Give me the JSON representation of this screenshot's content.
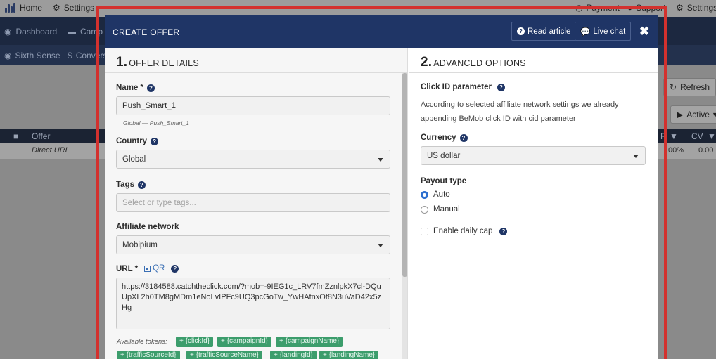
{
  "topbar": {
    "home": "Home",
    "settings_left": "Settings",
    "payment": "Payment",
    "support": "Support",
    "settings_right": "Settings"
  },
  "navbar": {
    "dashboard": "Dashboard",
    "campaigns": "Camp"
  },
  "subnav": {
    "sixth_sense": "Sixth Sense",
    "conversions": "Convers"
  },
  "toolbar": {
    "refresh": "Refresh",
    "active": "Active"
  },
  "table": {
    "col_offer": "Offer",
    "col_r": "R",
    "col_cv": "CV",
    "row_name": "Direct URL",
    "row_pct1": "00%",
    "row_pct2": "0.00"
  },
  "modal": {
    "title": "CREATE OFFER",
    "read_article": "Read article",
    "live_chat": "Live chat",
    "close": "✖"
  },
  "offer_details": {
    "num": "1.",
    "title": "OFFER DETAILS",
    "name_label": "Name *",
    "name_value": "Push_Smart_1",
    "name_hint": "Global — Push_Smart_1",
    "country_label": "Country",
    "country_value": "Global",
    "tags_label": "Tags",
    "tags_placeholder": "Select or type tags...",
    "affiliate_label": "Affiliate network",
    "affiliate_value": "Mobipium",
    "url_label": "URL *",
    "qr_label": "QR",
    "url_value": "https://3184588.catchtheclick.com/?mob=-9IEG1c_LRV7fmZznlpkX7cl-DQuUpXL2h0TM8gMDm1eNoLvIPFc9UQ3pcGoTw_YwHAfnxOf8N3uVaD42x5zHg",
    "tokens_label": "Available tokens:",
    "tokens": [
      "+ {clickId}",
      "+ {campaignId}",
      "+ {campaignName}",
      "+ {trafficSourceId}",
      "+ {trafficSourceName}",
      "+ {landingId}",
      "+ {landingName}"
    ]
  },
  "advanced": {
    "num": "2.",
    "title": "ADVANCED OPTIONS",
    "clickid_label": "Click ID parameter",
    "clickid_desc": "According to selected affiliate network settings we already appending BeMob click ID with cid parameter",
    "currency_label": "Currency",
    "currency_value": "US dollar",
    "payout_label": "Payout type",
    "payout_auto": "Auto",
    "payout_manual": "Manual",
    "daily_cap": "Enable daily cap"
  },
  "colors": {
    "header": "#1f3566",
    "accent": "#2d6fcf",
    "token": "#3c9d6c",
    "frame": "#d3312e"
  }
}
